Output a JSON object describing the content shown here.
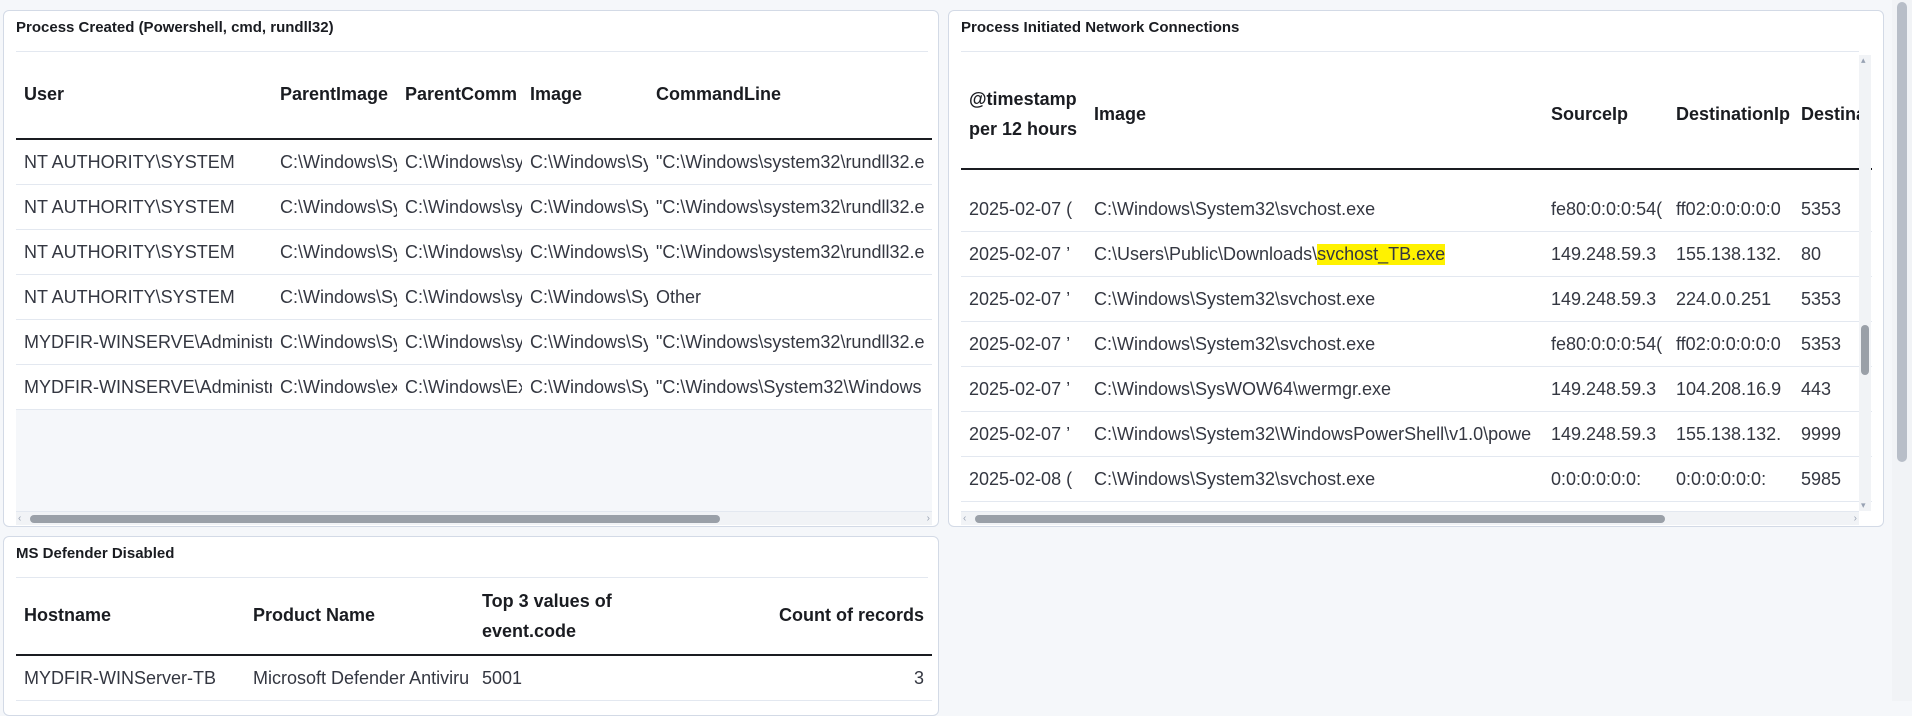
{
  "panels": {
    "process_created": {
      "title": "Process Created (Powershell, cmd, rundll32)",
      "columns": [
        "User",
        "ParentImage",
        "ParentComm",
        "Image",
        "CommandLine"
      ],
      "rows": [
        [
          "NT AUTHORITY\\SYSTEM",
          "C:\\Windows\\Sy",
          "C:\\Windows\\sy",
          "C:\\Windows\\Sy",
          "\"C:\\Windows\\system32\\rundll32.e"
        ],
        [
          "NT AUTHORITY\\SYSTEM",
          "C:\\Windows\\Sy",
          "C:\\Windows\\sy",
          "C:\\Windows\\Sy",
          "\"C:\\Windows\\system32\\rundll32.e"
        ],
        [
          "NT AUTHORITY\\SYSTEM",
          "C:\\Windows\\Sy",
          "C:\\Windows\\sy",
          "C:\\Windows\\Sy",
          "\"C:\\Windows\\system32\\rundll32.e"
        ],
        [
          "NT AUTHORITY\\SYSTEM",
          "C:\\Windows\\Sy",
          "C:\\Windows\\sy",
          "C:\\Windows\\Sy",
          "Other"
        ],
        [
          "MYDFIR-WINSERVE\\Administr",
          "C:\\Windows\\Sy",
          "C:\\Windows\\sy",
          "C:\\Windows\\Sy",
          "\"C:\\Windows\\system32\\rundll32.e"
        ],
        [
          "MYDFIR-WINSERVE\\Administr",
          "C:\\Windows\\ex",
          "C:\\Windows\\Ex",
          "C:\\Windows\\Sy",
          "\"C:\\Windows\\System32\\Windows"
        ]
      ]
    },
    "network": {
      "title": "Process Initiated Network Connections",
      "columns": [
        "@timestamp per 12 hours",
        "Image",
        "SourceIp",
        "DestinationIp",
        "Destina"
      ],
      "rows": [
        [
          "2025-02-07 (",
          "C:\\Windows\\System32\\svchost.exe",
          "fe80:0:0:0:54(",
          "ff02:0:0:0:0:0",
          "5353"
        ],
        [
          "2025-02-07 ’",
          "C:\\Users\\Public\\Downloads\\",
          "149.248.59.3",
          "155.138.132.",
          "80"
        ],
        [
          "2025-02-07 ’",
          "C:\\Windows\\System32\\svchost.exe",
          "149.248.59.3",
          "224.0.0.251",
          "5353"
        ],
        [
          "2025-02-07 ’",
          "C:\\Windows\\System32\\svchost.exe",
          "fe80:0:0:0:54(",
          "ff02:0:0:0:0:0",
          "5353"
        ],
        [
          "2025-02-07 ’",
          "C:\\Windows\\SysWOW64\\wermgr.exe",
          "149.248.59.3",
          "104.208.16.9",
          "443"
        ],
        [
          "2025-02-07 ’",
          "C:\\Windows\\System32\\WindowsPowerShell\\v1.0\\powe",
          "149.248.59.3",
          "155.138.132.",
          "9999"
        ],
        [
          "2025-02-08 (",
          "C:\\Windows\\System32\\svchost.exe",
          "0:0:0:0:0:0:",
          "0:0:0:0:0:0:",
          "5985"
        ]
      ],
      "highlight_text": "svchost_TB.exe",
      "highlight_color": "#fff200"
    },
    "defender": {
      "title": "MS Defender Disabled",
      "columns": [
        "Hostname",
        "Product Name",
        "Top 3 values of event.code",
        "Count of records"
      ],
      "rows": [
        [
          "MYDFIR-WINServer-TB",
          "Microsoft Defender Antiviru",
          "5001",
          "3"
        ]
      ]
    }
  },
  "icons": {
    "scroll_left": "‹",
    "scroll_right": "›",
    "scroll_up": "▴",
    "scroll_down": "▾"
  },
  "colors": {
    "page_bg": "#f5f7fa",
    "panel_border": "#d3dae6",
    "header_rule": "#1a1c21"
  }
}
